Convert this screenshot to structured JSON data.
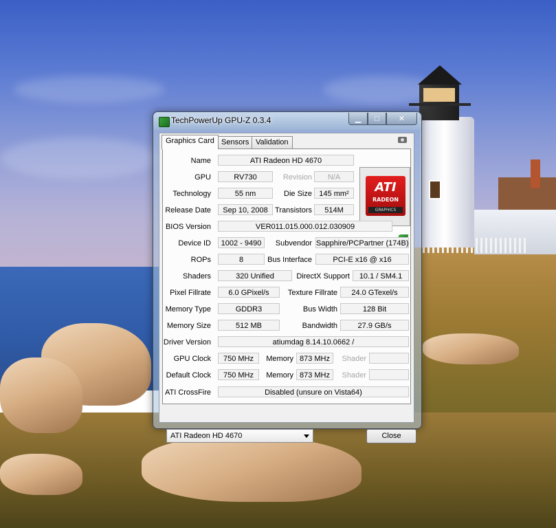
{
  "window": {
    "title": "TechPowerUp GPU-Z 0.3.4",
    "minimize_glyph": "▁",
    "maximize_glyph": "□",
    "close_glyph": "✕"
  },
  "tabs": [
    "Graphics Card",
    "Sensors",
    "Validation"
  ],
  "logo": {
    "brand": "ATI",
    "product": "RADEON",
    "sub": "GRAPHICS"
  },
  "fields": {
    "name_label": "Name",
    "name": "ATI Radeon HD 4670",
    "gpu_label": "GPU",
    "gpu": "RV730",
    "revision_label": "Revision",
    "revision": "N/A",
    "technology_label": "Technology",
    "technology": "55 nm",
    "die_size_label": "Die Size",
    "die_size": "145 mm²",
    "release_date_label": "Release Date",
    "release_date": "Sep 10, 2008",
    "transistors_label": "Transistors",
    "transistors": "514M",
    "bios_label": "BIOS Version",
    "bios": "VER011.015.000.012.030909",
    "device_id_label": "Device ID",
    "device_id": "1002 - 9490",
    "subvendor_label": "Subvendor",
    "subvendor": "Sapphire/PCPartner (174B)",
    "rops_label": "ROPs",
    "rops": "8",
    "bus_interface_label": "Bus Interface",
    "bus_interface": "PCI-E x16 @ x16",
    "shaders_label": "Shaders",
    "shaders": "320 Unified",
    "directx_label": "DirectX Support",
    "directx": "10.1 / SM4.1",
    "pixel_fillrate_label": "Pixel Fillrate",
    "pixel_fillrate": "6.0 GPixel/s",
    "texture_fillrate_label": "Texture Fillrate",
    "texture_fillrate": "24.0 GTexel/s",
    "memory_type_label": "Memory Type",
    "memory_type": "GDDR3",
    "bus_width_label": "Bus Width",
    "bus_width": "128 Bit",
    "memory_size_label": "Memory Size",
    "memory_size": "512 MB",
    "bandwidth_label": "Bandwidth",
    "bandwidth": "27.9 GB/s",
    "driver_label": "Driver Version",
    "driver": "atiumdag 8.14.10.0662 /",
    "gpu_clock_label": "GPU Clock",
    "gpu_clock": "750 MHz",
    "memory_label": "Memory",
    "memory_clock": "873 MHz",
    "shader_label": "Shader",
    "shader_clock": "",
    "default_clock_label": "Default Clock",
    "default_clock": "750 MHz",
    "default_memory_clock": "873 MHz",
    "default_shader_clock": "",
    "crossfire_label": "ATI CrossFire",
    "crossfire": "Disabled (unsure on Vista64)"
  },
  "footer": {
    "selected_card": "ATI Radeon HD 4670",
    "close_label": "Close"
  }
}
